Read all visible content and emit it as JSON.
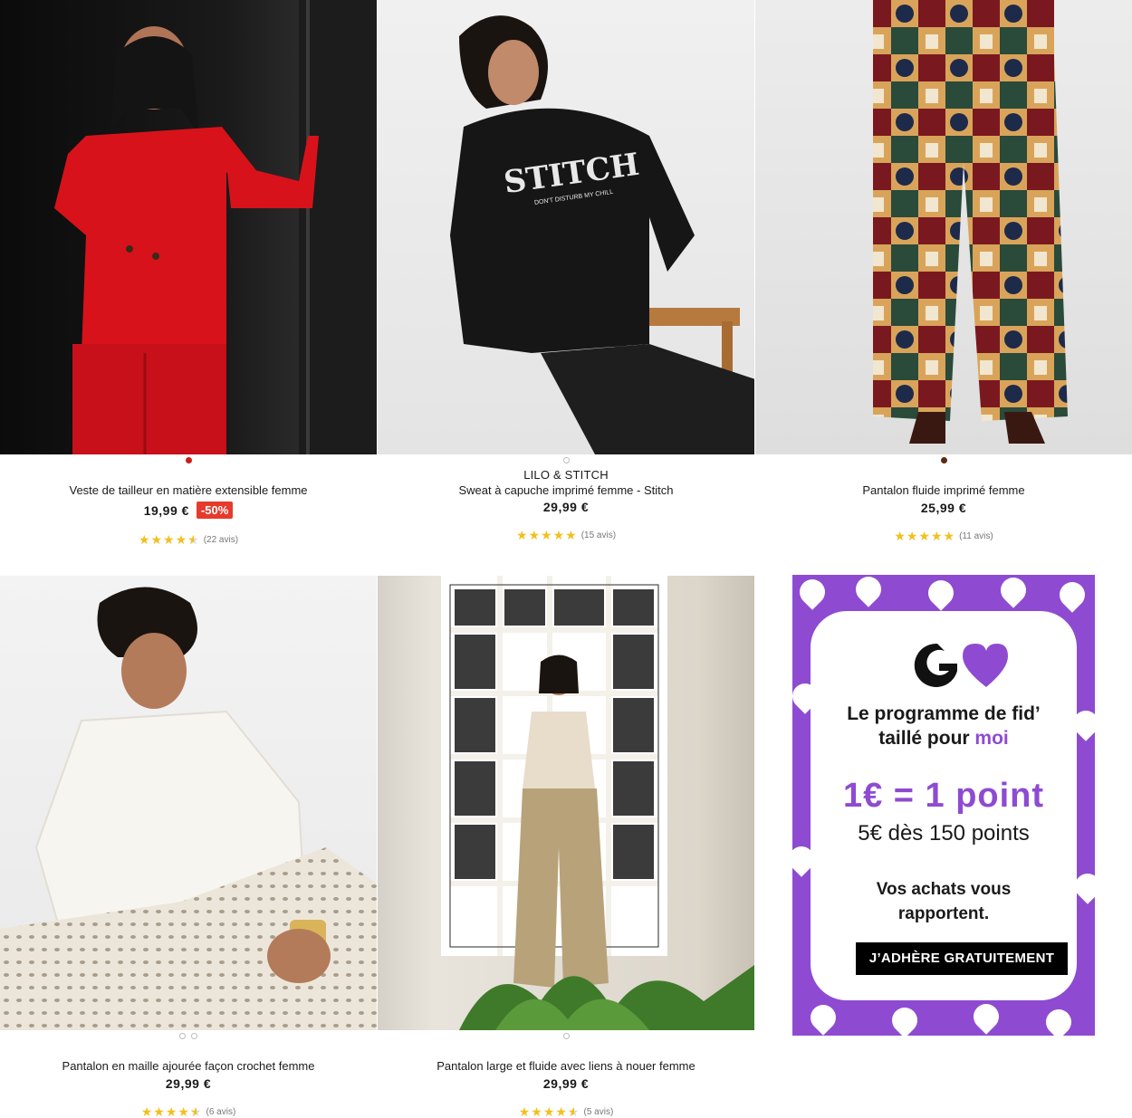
{
  "products": [
    {
      "brand": "",
      "name": "Veste de tailleur en matière extensible femme",
      "price": "19,99 €",
      "discount": "-50%",
      "rating": 4.5,
      "reviews": "(22 avis)"
    },
    {
      "brand": "LILO & STITCH",
      "name": "Sweat à capuche imprimé femme - Stitch",
      "price": "29,99 €",
      "discount": "",
      "rating": 5,
      "reviews": "(15 avis)",
      "print_text": "STITCH",
      "print_sub": "DON'T DISTURB MY CHILL"
    },
    {
      "brand": "",
      "name": "Pantalon fluide imprimé femme",
      "price": "25,99 €",
      "discount": "",
      "rating": 5,
      "reviews": "(11 avis)"
    },
    {
      "brand": "",
      "name": "Pantalon en maille ajourée façon crochet femme",
      "price": "29,99 €",
      "discount": "",
      "rating": 4.5,
      "reviews": "(6 avis)"
    },
    {
      "brand": "",
      "name": "Pantalon large et fluide avec liens à nouer femme",
      "price": "29,99 €",
      "discount": "",
      "rating": 4.5,
      "reviews": "(5 avis)"
    }
  ],
  "promo": {
    "logo_letter": "G",
    "line1": "Le programme de fid’",
    "line2_start": "taillé pour ",
    "line2_accent": "moi",
    "points": "1€ = 1 point",
    "points_sub": "5€ dès 150 points",
    "earn_line1": "Vos achats vous",
    "earn_line2": "rapportent.",
    "button": "J’ADHÈRE GRATUITEMENT"
  },
  "colors": {
    "accent_purple": "#8e4bd1",
    "discount_red": "#e53a2c",
    "star_yellow": "#f2c01d",
    "swatch_red": "#d11a1a",
    "swatch_brown": "#5a2a12"
  }
}
